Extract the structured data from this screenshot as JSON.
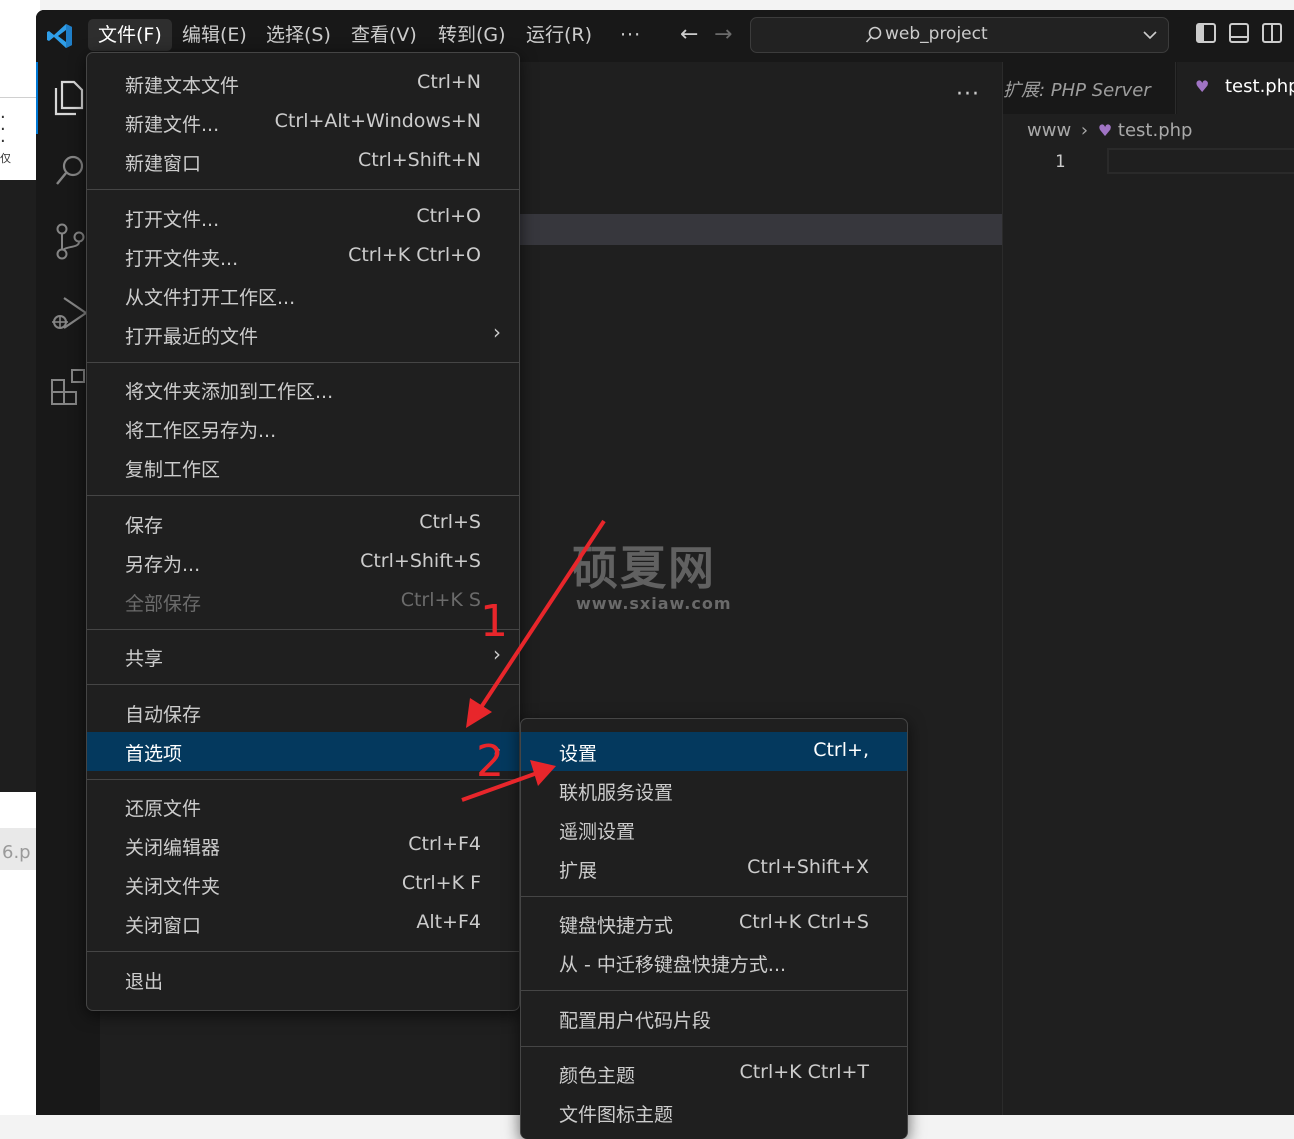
{
  "background_window": {
    "partial_text": "6.p",
    "small_text": "仅"
  },
  "titlebar": {
    "menus": [
      {
        "label": "文件(F)"
      },
      {
        "label": "编辑(E)"
      },
      {
        "label": "选择(S)"
      },
      {
        "label": "查看(V)"
      },
      {
        "label": "转到(G)"
      },
      {
        "label": "运行(R)"
      }
    ],
    "more_label": "···",
    "search_text": "web_project"
  },
  "sidebar": {
    "more_label": "···"
  },
  "editor": {
    "tab1_label": "扩展: PHP Server",
    "tab2_label": "test.php",
    "breadcrumb_folder": "www",
    "breadcrumb_file": "test.php",
    "line_number": "1"
  },
  "file_menu": {
    "items": [
      {
        "label": "新建文本文件",
        "shortcut": "Ctrl+N"
      },
      {
        "label": "新建文件...",
        "shortcut": "Ctrl+Alt+Windows+N"
      },
      {
        "label": "新建窗口",
        "shortcut": "Ctrl+Shift+N"
      },
      {
        "label": "打开文件...",
        "shortcut": "Ctrl+O"
      },
      {
        "label": "打开文件夹...",
        "shortcut": "Ctrl+K Ctrl+O"
      },
      {
        "label": "从文件打开工作区...",
        "shortcut": ""
      },
      {
        "label": "打开最近的文件",
        "shortcut": ""
      },
      {
        "label": "将文件夹添加到工作区...",
        "shortcut": ""
      },
      {
        "label": "将工作区另存为...",
        "shortcut": ""
      },
      {
        "label": "复制工作区",
        "shortcut": ""
      },
      {
        "label": "保存",
        "shortcut": "Ctrl+S"
      },
      {
        "label": "另存为...",
        "shortcut": "Ctrl+Shift+S"
      },
      {
        "label": "全部保存",
        "shortcut": "Ctrl+K S"
      },
      {
        "label": "共享",
        "shortcut": ""
      },
      {
        "label": "自动保存",
        "shortcut": ""
      },
      {
        "label": "首选项",
        "shortcut": ""
      },
      {
        "label": "还原文件",
        "shortcut": ""
      },
      {
        "label": "关闭编辑器",
        "shortcut": "Ctrl+F4"
      },
      {
        "label": "关闭文件夹",
        "shortcut": "Ctrl+K F"
      },
      {
        "label": "关闭窗口",
        "shortcut": "Alt+F4"
      },
      {
        "label": "退出",
        "shortcut": ""
      }
    ]
  },
  "preferences_menu": {
    "items": [
      {
        "label": "设置",
        "shortcut": "Ctrl+,"
      },
      {
        "label": "联机服务设置",
        "shortcut": ""
      },
      {
        "label": "遥测设置",
        "shortcut": ""
      },
      {
        "label": "扩展",
        "shortcut": "Ctrl+Shift+X"
      },
      {
        "label": "键盘快捷方式",
        "shortcut": "Ctrl+K Ctrl+S"
      },
      {
        "label": "从 - 中迁移键盘快捷方式...",
        "shortcut": ""
      },
      {
        "label": "配置用户代码片段",
        "shortcut": ""
      },
      {
        "label": "颜色主题",
        "shortcut": "Ctrl+K Ctrl+T"
      },
      {
        "label": "文件图标主题",
        "shortcut": ""
      }
    ]
  },
  "watermark": {
    "title": "硕夏网",
    "url": "www.sxiaw.com"
  },
  "annotations": {
    "step1": "1",
    "step2": "2"
  },
  "colors": {
    "accent": "#0078d4",
    "selection": "#04395e",
    "annotation_red": "#e8262b",
    "php_icon": "#a074c4"
  }
}
